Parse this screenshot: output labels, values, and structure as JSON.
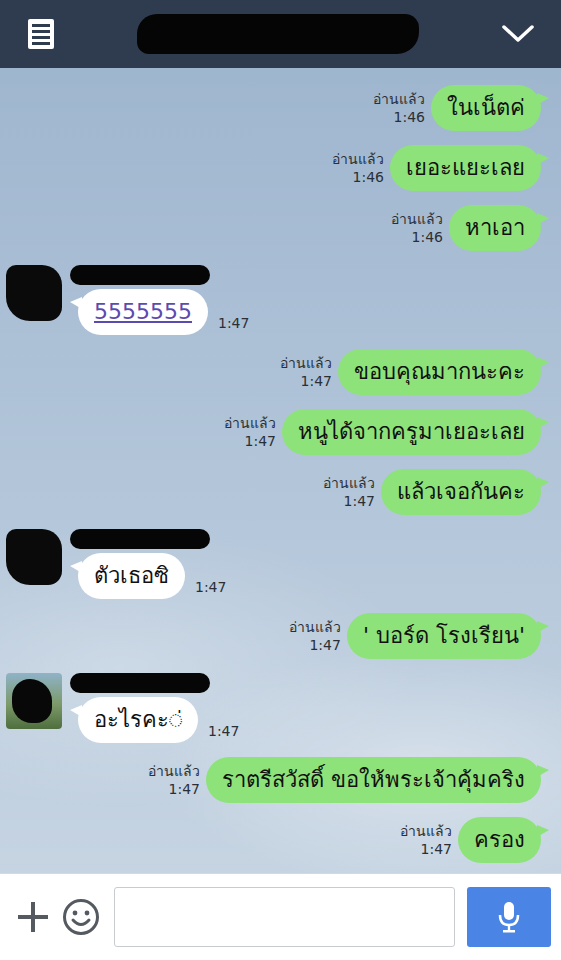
{
  "messages": [
    {
      "kind": "sent",
      "text": "ในเน็ตค่",
      "read_label": "อ่านแล้ว",
      "time": "1:46",
      "link": false,
      "avatar_photo": false
    },
    {
      "kind": "sent",
      "text": "เยอะแยะเลย",
      "read_label": "อ่านแล้ว",
      "time": "1:46",
      "link": false,
      "avatar_photo": false
    },
    {
      "kind": "sent",
      "text": "หาเอา",
      "read_label": "อ่านแล้ว",
      "time": "1:46",
      "link": false,
      "avatar_photo": false
    },
    {
      "kind": "received",
      "text": "5555555",
      "read_label": "",
      "time": "1:47",
      "link": true,
      "avatar_photo": false
    },
    {
      "kind": "sent",
      "text": "ขอบคุณมากนะคะ",
      "read_label": "อ่านแล้ว",
      "time": "1:47",
      "link": false,
      "avatar_photo": false
    },
    {
      "kind": "sent",
      "text": "หนูได้จากครูมาเยอะเลย",
      "read_label": "อ่านแล้ว",
      "time": "1:47",
      "link": false,
      "avatar_photo": false
    },
    {
      "kind": "sent",
      "text": "แล้วเจอกันคะ",
      "read_label": "อ่านแล้ว",
      "time": "1:47",
      "link": false,
      "avatar_photo": false
    },
    {
      "kind": "received",
      "text": "ตัวเธอซิ",
      "read_label": "",
      "time": "1:47",
      "link": false,
      "avatar_photo": false
    },
    {
      "kind": "sent",
      "text": "' บอร์ด โรงเรียน'",
      "read_label": "อ่านแล้ว",
      "time": "1:47",
      "link": false,
      "avatar_photo": false
    },
    {
      "kind": "received",
      "text": "อะไรคะ◌่",
      "read_label": "",
      "time": "1:47",
      "link": false,
      "avatar_photo": true
    },
    {
      "kind": "sent",
      "text": "ราตรีสวัสดิ์ ขอให้พระเจ้าคุ้มคริง",
      "read_label": "อ่านแล้ว",
      "time": "1:47",
      "link": false,
      "avatar_photo": false
    },
    {
      "kind": "sent",
      "text": "ครอง",
      "read_label": "อ่านแล้ว",
      "time": "1:47",
      "link": false,
      "avatar_photo": false
    }
  ]
}
